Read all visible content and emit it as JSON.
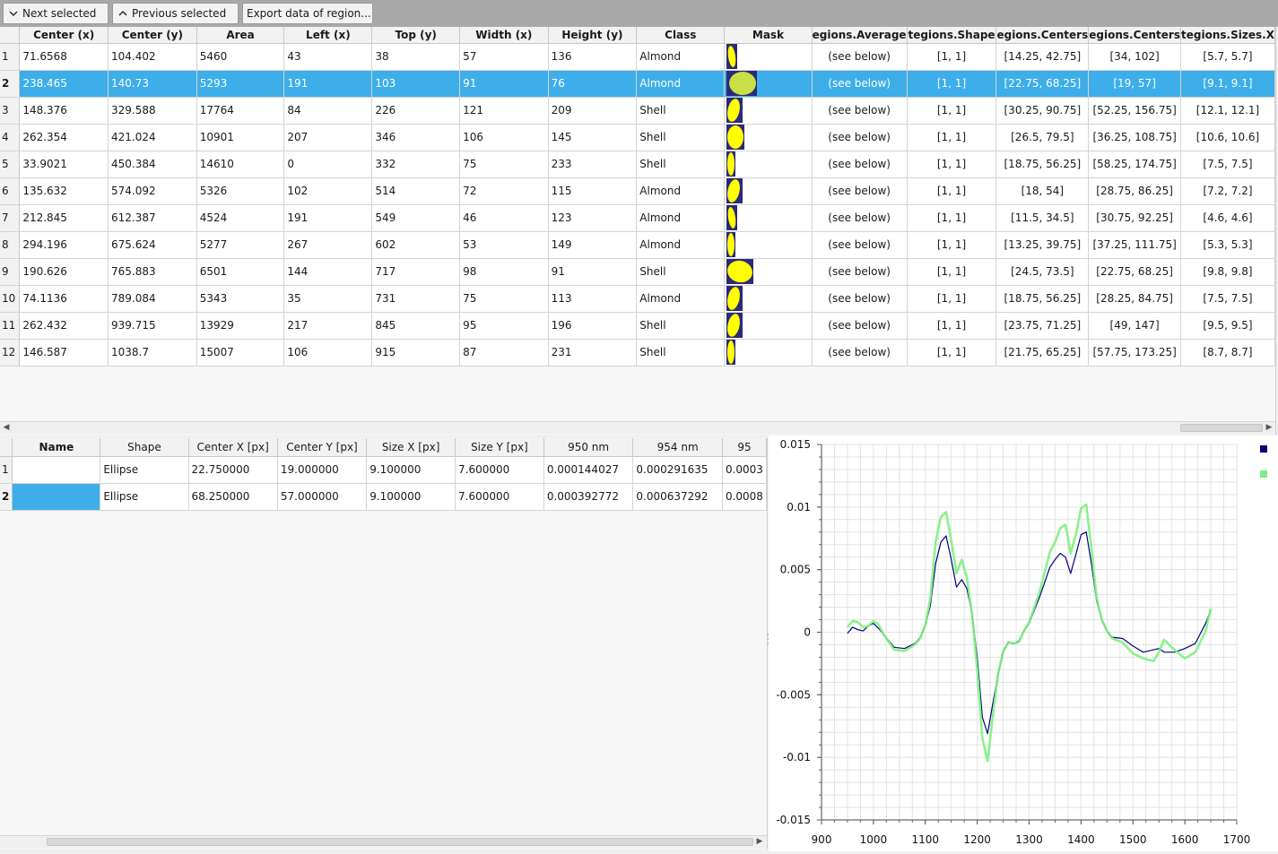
{
  "toolbar": {
    "next_label": "Next selected",
    "prev_label": "Previous selected",
    "export_label": "Export data of region..."
  },
  "regions_table": {
    "columns": [
      "Center (x)",
      "Center (y)",
      "Area",
      "Left (x)",
      "Top (y)",
      "Width (x)",
      "Height (y)",
      "Class",
      "Mask",
      "egions.Average",
      "tegions.Shape",
      "egions.Centers",
      "egions.Centers",
      "tegions.Sizes.X"
    ],
    "selected_row": 2,
    "rows": [
      {
        "index": "1",
        "cx": "71.6568",
        "cy": "104.402",
        "area": "5460",
        "left": "43",
        "top": "38",
        "width": "57",
        "height": "136",
        "cls": "Almond",
        "avg": "(see below)",
        "shape": "[1, 1]",
        "centers1": "[14.25, 42.75]",
        "centers2": "[34, 102]",
        "sizes": "[5.7, 5.7]",
        "mask": "narrow"
      },
      {
        "index": "2",
        "cx": "238.465",
        "cy": "140.73",
        "area": "5293",
        "left": "191",
        "top": "103",
        "width": "91",
        "height": "76",
        "cls": "Almond",
        "avg": "(see below)",
        "shape": "[1, 1]",
        "centers1": "[22.75, 68.25]",
        "centers2": "[19, 57]",
        "sizes": "[9.1, 9.1]",
        "mask": "round"
      },
      {
        "index": "3",
        "cx": "148.376",
        "cy": "329.588",
        "area": "17764",
        "left": "84",
        "top": "226",
        "width": "121",
        "height": "209",
        "cls": "Shell",
        "avg": "(see below)",
        "shape": "[1, 1]",
        "centers1": "[30.25, 90.75]",
        "centers2": "[52.25, 156.75]",
        "sizes": "[12.1, 12.1]",
        "mask": "tall"
      },
      {
        "index": "4",
        "cx": "262.354",
        "cy": "421.024",
        "area": "10901",
        "left": "207",
        "top": "346",
        "width": "106",
        "height": "145",
        "cls": "Shell",
        "avg": "(see below)",
        "shape": "[1, 1]",
        "centers1": "[26.5, 79.5]",
        "centers2": "[36.25, 108.75]",
        "sizes": "[10.6, 10.6]",
        "mask": "wide"
      },
      {
        "index": "5",
        "cx": "33.9021",
        "cy": "450.384",
        "area": "14610",
        "left": "0",
        "top": "332",
        "width": "75",
        "height": "233",
        "cls": "Shell",
        "avg": "(see below)",
        "shape": "[1, 1]",
        "centers1": "[18.75, 56.25]",
        "centers2": "[58.25, 174.75]",
        "sizes": "[7.5, 7.5]",
        "mask": "thin"
      },
      {
        "index": "6",
        "cx": "135.632",
        "cy": "574.092",
        "area": "5326",
        "left": "102",
        "top": "514",
        "width": "72",
        "height": "115",
        "cls": "Almond",
        "avg": "(see below)",
        "shape": "[1, 1]",
        "centers1": "[18, 54]",
        "centers2": "[28.75, 86.25]",
        "sizes": "[7.2, 7.2]",
        "mask": "tall"
      },
      {
        "index": "7",
        "cx": "212.845",
        "cy": "612.387",
        "area": "4524",
        "left": "191",
        "top": "549",
        "width": "46",
        "height": "123",
        "cls": "Almond",
        "avg": "(see below)",
        "shape": "[1, 1]",
        "centers1": "[11.5, 34.5]",
        "centers2": "[30.75, 92.25]",
        "sizes": "[4.6, 4.6]",
        "mask": "narrow"
      },
      {
        "index": "8",
        "cx": "294.196",
        "cy": "675.624",
        "area": "5277",
        "left": "267",
        "top": "602",
        "width": "53",
        "height": "149",
        "cls": "Almond",
        "avg": "(see below)",
        "shape": "[1, 1]",
        "centers1": "[13.25, 39.75]",
        "centers2": "[37.25, 111.75]",
        "sizes": "[5.3, 5.3]",
        "mask": "thin"
      },
      {
        "index": "9",
        "cx": "190.626",
        "cy": "765.883",
        "area": "6501",
        "left": "144",
        "top": "717",
        "width": "98",
        "height": "91",
        "cls": "Shell",
        "avg": "(see below)",
        "shape": "[1, 1]",
        "centers1": "[24.5, 73.5]",
        "centers2": "[22.75, 68.25]",
        "sizes": "[9.8, 9.8]",
        "mask": "blob"
      },
      {
        "index": "10",
        "cx": "74.1136",
        "cy": "789.084",
        "area": "5343",
        "left": "35",
        "top": "731",
        "width": "75",
        "height": "113",
        "cls": "Almond",
        "avg": "(see below)",
        "shape": "[1, 1]",
        "centers1": "[18.75, 56.25]",
        "centers2": "[28.25, 84.75]",
        "sizes": "[7.5, 7.5]",
        "mask": "tall"
      },
      {
        "index": "11",
        "cx": "262.432",
        "cy": "939.715",
        "area": "13929",
        "left": "217",
        "top": "845",
        "width": "95",
        "height": "196",
        "cls": "Shell",
        "avg": "(see below)",
        "shape": "[1, 1]",
        "centers1": "[23.75, 71.25]",
        "centers2": "[49, 147]",
        "sizes": "[9.5, 9.5]",
        "mask": "tall"
      },
      {
        "index": "12",
        "cx": "146.587",
        "cy": "1038.7",
        "area": "15007",
        "left": "106",
        "top": "915",
        "width": "87",
        "height": "231",
        "cls": "Shell",
        "avg": "(see below)",
        "shape": "[1, 1]",
        "centers1": "[21.75, 65.25]",
        "centers2": "[57.75, 173.25]",
        "sizes": "[8.7, 8.7]",
        "mask": "thin"
      }
    ]
  },
  "subregions_table": {
    "columns": [
      "Name",
      "Shape",
      "Center X [px]",
      "Center Y [px]",
      "Size X [px]",
      "Size Y [px]",
      "950 nm",
      "954 nm",
      "95"
    ],
    "rows": [
      {
        "index": "1",
        "name": "",
        "shape": "Ellipse",
        "cx": "22.750000",
        "cy": "19.000000",
        "sx": "9.100000",
        "sy": "7.600000",
        "v950": "0.000144027",
        "v954": "0.000291635",
        "v95x": "0.0003"
      },
      {
        "index": "2",
        "name": "",
        "shape": "Ellipse",
        "cx": "68.250000",
        "cy": "57.000000",
        "sx": "9.100000",
        "sy": "7.600000",
        "v950": "0.000392772",
        "v954": "0.000637292",
        "v95x": "0.0008"
      }
    ]
  },
  "chart_data": {
    "type": "line",
    "title": "",
    "xlabel": "",
    "ylabel": "",
    "xlim": [
      900,
      1700
    ],
    "ylim": [
      -0.015,
      0.015
    ],
    "xticks": [
      "900",
      "1000",
      "1100",
      "1200",
      "1300",
      "1400",
      "1500",
      "1600",
      "1700"
    ],
    "yticks": [
      "-0.015",
      "-0.01",
      "-0.005",
      "0",
      "0.005",
      "0.01",
      "0.015"
    ],
    "grid": true,
    "legend": "top-right",
    "series": [
      {
        "color": "#00007f",
        "x": [
          950,
          960,
          970,
          980,
          990,
          1000,
          1010,
          1020,
          1040,
          1060,
          1080,
          1090,
          1100,
          1110,
          1120,
          1130,
          1140,
          1150,
          1160,
          1170,
          1180,
          1190,
          1200,
          1210,
          1220,
          1230,
          1240,
          1250,
          1260,
          1270,
          1280,
          1290,
          1300,
          1320,
          1340,
          1350,
          1360,
          1370,
          1380,
          1390,
          1400,
          1410,
          1420,
          1430,
          1440,
          1450,
          1460,
          1480,
          1500,
          1520,
          1540,
          1550,
          1560,
          1580,
          1600,
          1620,
          1640,
          1650
        ],
        "y": [
          -0.0001,
          0.0004,
          0.0002,
          0.0001,
          0.0005,
          0.0007,
          0.0003,
          -0.0002,
          -0.0012,
          -0.0013,
          -0.0009,
          -0.0004,
          0.0005,
          0.0022,
          0.0055,
          0.0072,
          0.0077,
          0.0058,
          0.0036,
          0.0042,
          0.0035,
          0.0015,
          -0.002,
          -0.0068,
          -0.0081,
          -0.0057,
          -0.0034,
          -0.0016,
          -0.0008,
          -0.0009,
          -0.0007,
          0.0001,
          0.0007,
          0.0028,
          0.0052,
          0.0058,
          0.0063,
          0.006,
          0.0047,
          0.0062,
          0.0078,
          0.008,
          0.0055,
          0.0025,
          0.001,
          0.0001,
          -0.0004,
          -0.0005,
          -0.0011,
          -0.0016,
          -0.0014,
          -0.0013,
          -0.0016,
          -0.0016,
          -0.0013,
          -0.0009,
          0.0007,
          0.0018
        ]
      },
      {
        "color": "#7ff07f",
        "x": [
          950,
          960,
          970,
          980,
          990,
          1000,
          1010,
          1020,
          1040,
          1060,
          1080,
          1090,
          1100,
          1110,
          1120,
          1130,
          1140,
          1150,
          1160,
          1170,
          1180,
          1190,
          1200,
          1210,
          1220,
          1230,
          1240,
          1250,
          1260,
          1270,
          1280,
          1290,
          1300,
          1320,
          1340,
          1350,
          1360,
          1370,
          1380,
          1390,
          1400,
          1410,
          1420,
          1430,
          1440,
          1450,
          1460,
          1480,
          1500,
          1520,
          1540,
          1550,
          1560,
          1580,
          1600,
          1620,
          1640,
          1650
        ],
        "y": [
          0.0004,
          0.0009,
          0.0008,
          0.0004,
          0.0005,
          0.0009,
          0.0006,
          -0.0002,
          -0.0014,
          -0.0015,
          -0.001,
          -0.0005,
          0.0006,
          0.0028,
          0.0072,
          0.0092,
          0.0096,
          0.0073,
          0.0047,
          0.0058,
          0.0044,
          0.0015,
          -0.003,
          -0.0085,
          -0.0103,
          -0.0067,
          -0.0034,
          -0.0015,
          -0.0008,
          -0.0009,
          -0.0008,
          0.0001,
          0.0008,
          0.0032,
          0.0064,
          0.0072,
          0.0083,
          0.0086,
          0.0063,
          0.0078,
          0.0099,
          0.0102,
          0.0067,
          0.0028,
          0.001,
          0.0001,
          -0.0005,
          -0.0008,
          -0.0017,
          -0.0021,
          -0.0023,
          -0.0016,
          -0.0006,
          -0.0014,
          -0.0021,
          -0.0016,
          0.0001,
          0.0019
        ]
      }
    ]
  }
}
